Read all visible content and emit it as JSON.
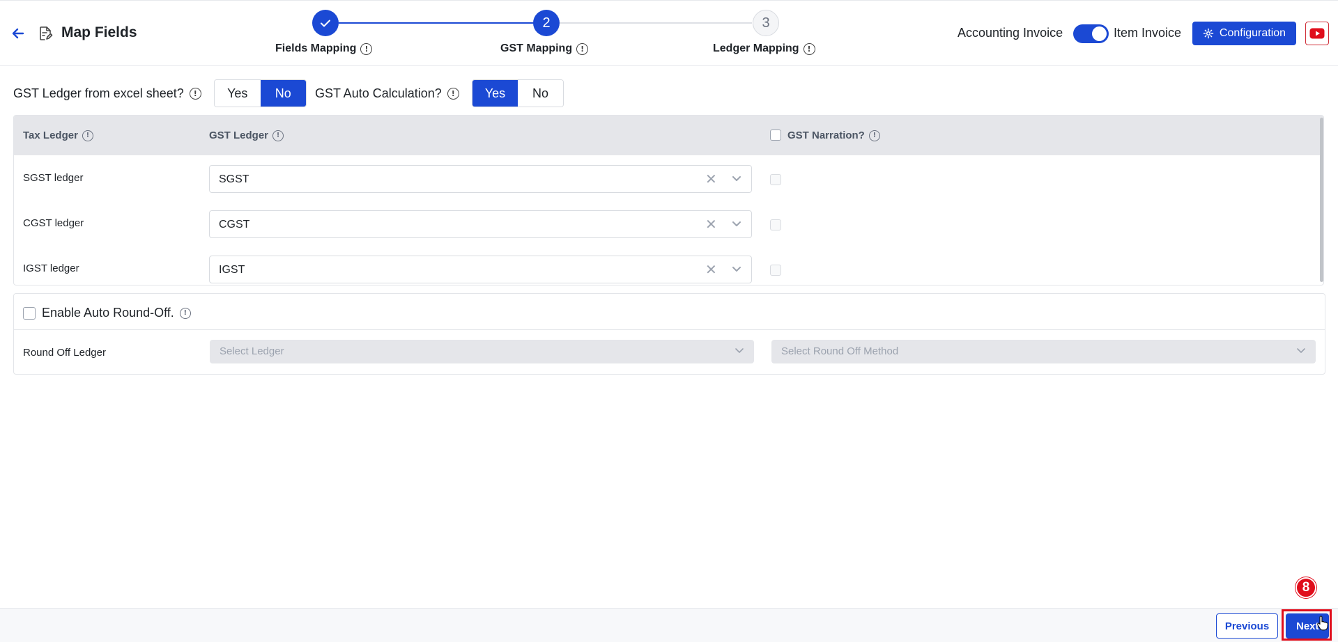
{
  "header": {
    "title": "Map Fields",
    "steps": [
      {
        "number": "1",
        "label": "Fields Mapping",
        "status": "completed"
      },
      {
        "number": "2",
        "label": "GST Mapping",
        "status": "active"
      },
      {
        "number": "3",
        "label": "Ledger Mapping",
        "status": "pending"
      }
    ],
    "toggle": {
      "left_label": "Accounting Invoice",
      "right_label": "Item Invoice",
      "state": "Item Invoice"
    },
    "config_label": "Configuration"
  },
  "questions": [
    {
      "label": "GST Ledger from excel sheet?",
      "options": [
        "Yes",
        "No"
      ],
      "selected": "No"
    },
    {
      "label": "GST Auto Calculation?",
      "options": [
        "Yes",
        "No"
      ],
      "selected": "Yes"
    }
  ],
  "table": {
    "headers": [
      "Tax Ledger",
      "GST Ledger",
      "GST Narration?"
    ],
    "rows": [
      {
        "label": "SGST ledger",
        "value": "SGST"
      },
      {
        "label": "CGST ledger",
        "value": "CGST"
      },
      {
        "label": "IGST ledger",
        "value": "IGST"
      }
    ]
  },
  "round_off": {
    "checkbox_label": "Enable Auto Round-Off.",
    "row_label": "Round Off Ledger",
    "ledger_placeholder": "Select Ledger",
    "method_placeholder": "Select Round Off Method"
  },
  "footer": {
    "previous_label": "Previous",
    "next_label": "Next"
  },
  "annotation": {
    "badge": "8",
    "color": "#e00d1b"
  },
  "colors": {
    "primary": "#1b49d4",
    "header_bg": "#e5e6ea"
  }
}
